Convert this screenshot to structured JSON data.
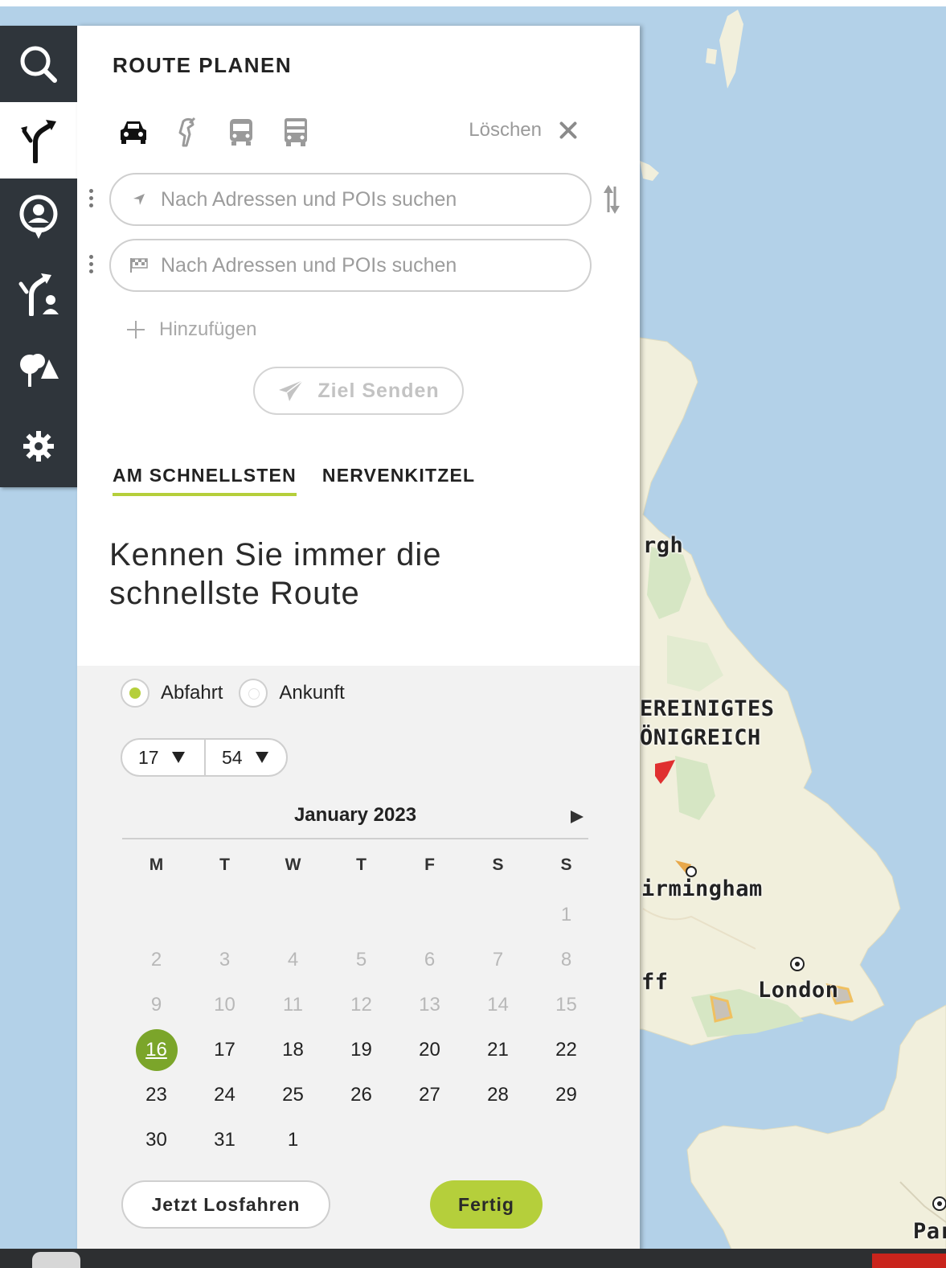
{
  "panel": {
    "title": "ROUTE PLANEN",
    "clear_label": "Löschen",
    "start_placeholder": "Nach Adressen und POIs suchen",
    "destination_placeholder": "Nach Adressen und POIs suchen",
    "add_label": "Hinzufügen",
    "send_label": "Ziel Senden",
    "tabs": [
      {
        "label": "AM SCHNELLSTEN",
        "active": true
      },
      {
        "label": "NERVENKITZEL",
        "active": false
      }
    ],
    "headline": "Kennen Sie immer die schnellste Route"
  },
  "rail": {
    "icons": [
      "search-icon",
      "route-icon",
      "profile-icon",
      "shared-route-icon",
      "places-icon",
      "settings-icon"
    ]
  },
  "transport_modes": [
    "car-icon",
    "motorbike-icon",
    "bus-icon",
    "truck-icon"
  ],
  "schedule": {
    "departure_label": "Abfahrt",
    "arrival_label": "Ankunft",
    "hour": "17",
    "minute": "54",
    "month_label": "January 2023",
    "weekdays": [
      "M",
      "T",
      "W",
      "T",
      "F",
      "S",
      "S"
    ],
    "weeks": [
      [
        "",
        "",
        "",
        "",
        "",
        "",
        "1"
      ],
      [
        "2",
        "3",
        "4",
        "5",
        "6",
        "7",
        "8"
      ],
      [
        "9",
        "10",
        "11",
        "12",
        "13",
        "14",
        "15"
      ],
      [
        "16",
        "17",
        "18",
        "19",
        "20",
        "21",
        "22"
      ],
      [
        "23",
        "24",
        "25",
        "26",
        "27",
        "28",
        "29"
      ],
      [
        "30",
        "31",
        "1",
        "",
        "",
        "",
        ""
      ]
    ],
    "today": "16",
    "now_label": "Jetzt Losfahren",
    "done_label": "Fertig"
  },
  "map": {
    "labels": {
      "edinburgh": "rgh",
      "uk_line1": "EREINIGTES",
      "uk_line2": "ÖNIGREICH",
      "birmingham": "irmingham",
      "cardiff": "ff",
      "london": "London",
      "paris": "Par"
    }
  },
  "colors": {
    "accent": "#b5cf3b",
    "today": "#7ba52a",
    "rail": "#2f353b",
    "sea": "#b3d1e8",
    "land": "#f2efdd"
  }
}
